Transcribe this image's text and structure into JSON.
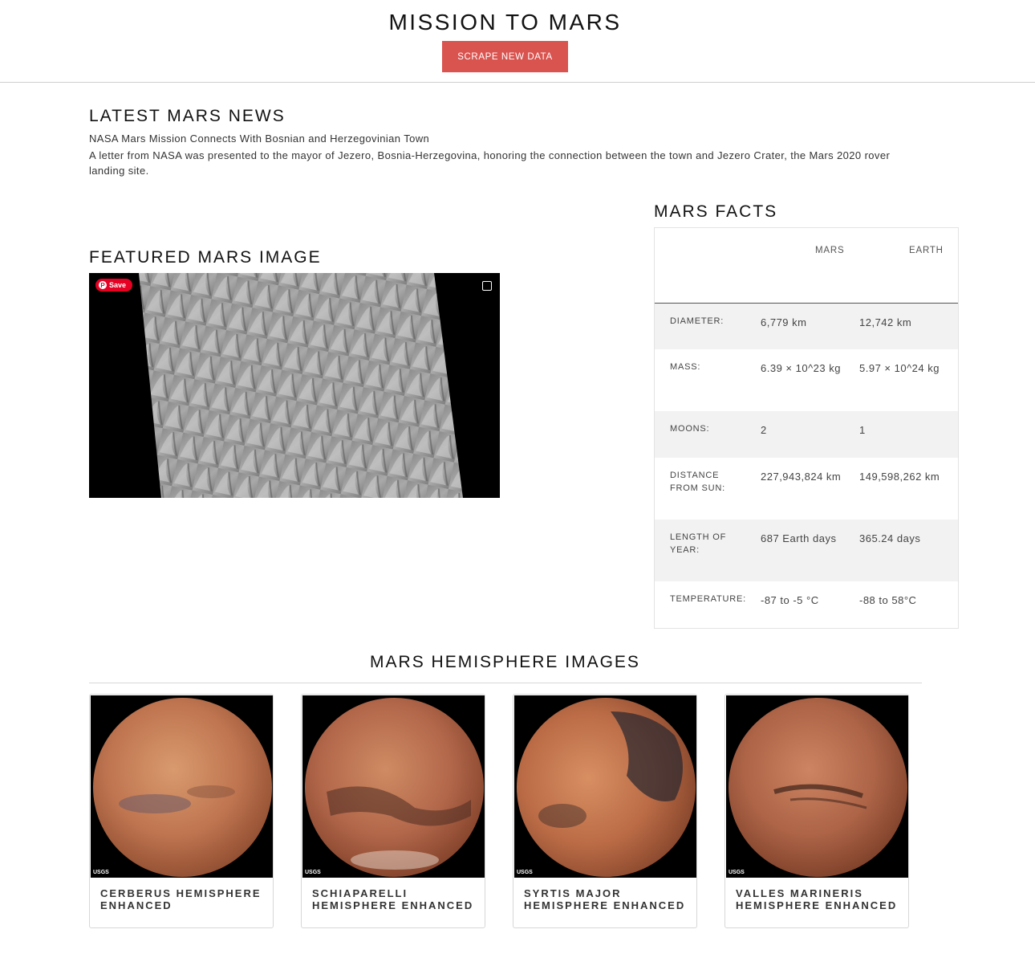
{
  "header": {
    "title": "MISSION TO MARS",
    "scrape_button": "SCRAPE NEW DATA"
  },
  "news": {
    "heading": "LATEST MARS NEWS",
    "title": "NASA Mars Mission Connects With Bosnian and Herzegovinian Town",
    "teaser": "A letter from NASA was presented to the mayor of Jezero, Bosnia-Herzegovina, honoring the connection between the town and Jezero Crater, the Mars 2020 rover landing site."
  },
  "featured": {
    "heading": "FEATURED MARS IMAGE",
    "save_label": "Save"
  },
  "facts": {
    "heading": "MARS FACTS",
    "columns": [
      "",
      "MARS",
      "EARTH"
    ],
    "rows": [
      {
        "label": "DIAMETER:",
        "mars": "6,779 km",
        "earth": "12,742 km"
      },
      {
        "label": "MASS:",
        "mars": "6.39 × 10^23 kg",
        "earth": "5.97 × 10^24 kg"
      },
      {
        "label": "MOONS:",
        "mars": "2",
        "earth": "1"
      },
      {
        "label": "DISTANCE FROM SUN:",
        "mars": "227,943,824 km",
        "earth": "149,598,262 km"
      },
      {
        "label": "LENGTH OF YEAR:",
        "mars": "687 Earth days",
        "earth": "365.24 days"
      },
      {
        "label": "TEMPERATURE:",
        "mars": "-87 to -5 °C",
        "earth": "-88 to 58°C"
      }
    ]
  },
  "hemispheres": {
    "heading": "MARS HEMISPHERE IMAGES",
    "items": [
      {
        "title": "CERBERUS HEMISPHERE ENHANCED",
        "watermark": "USGS"
      },
      {
        "title": "SCHIAPARELLI HEMISPHERE ENHANCED",
        "watermark": "USGS"
      },
      {
        "title": "SYRTIS MAJOR HEMISPHERE ENHANCED",
        "watermark": "USGS"
      },
      {
        "title": "VALLES MARINERIS HEMISPHERE ENHANCED",
        "watermark": "USGS"
      }
    ]
  },
  "colors": {
    "accent": "#d9534f",
    "pinterest": "#e60023",
    "table_shade": "#f2f2f2"
  }
}
